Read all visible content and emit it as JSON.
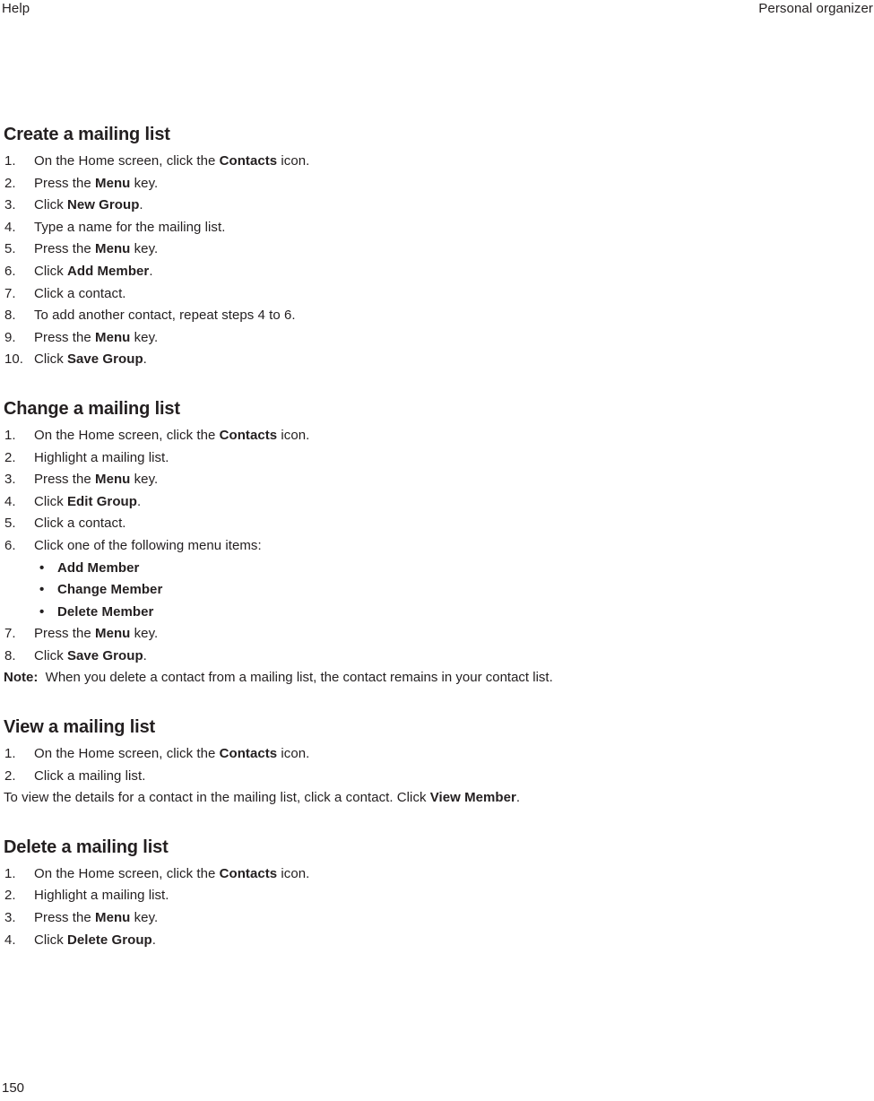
{
  "running_head": {
    "left": "Help",
    "right": "Personal organizer"
  },
  "page_number": "150",
  "sections": [
    {
      "title": "Create a mailing list",
      "steps": [
        {
          "num": "1.",
          "parts": [
            {
              "t": "On the Home screen, click the ",
              "b": false
            },
            {
              "t": "Contacts",
              "b": true
            },
            {
              "t": " icon.",
              "b": false
            }
          ]
        },
        {
          "num": "2.",
          "parts": [
            {
              "t": "Press the ",
              "b": false
            },
            {
              "t": "Menu",
              "b": true
            },
            {
              "t": " key.",
              "b": false
            }
          ]
        },
        {
          "num": "3.",
          "parts": [
            {
              "t": "Click ",
              "b": false
            },
            {
              "t": "New Group",
              "b": true
            },
            {
              "t": ".",
              "b": false
            }
          ]
        },
        {
          "num": "4.",
          "parts": [
            {
              "t": "Type a name for the mailing list.",
              "b": false
            }
          ]
        },
        {
          "num": "5.",
          "parts": [
            {
              "t": "Press the ",
              "b": false
            },
            {
              "t": "Menu",
              "b": true
            },
            {
              "t": " key.",
              "b": false
            }
          ]
        },
        {
          "num": "6.",
          "parts": [
            {
              "t": "Click ",
              "b": false
            },
            {
              "t": "Add Member",
              "b": true
            },
            {
              "t": ".",
              "b": false
            }
          ]
        },
        {
          "num": "7.",
          "parts": [
            {
              "t": "Click a contact.",
              "b": false
            }
          ]
        },
        {
          "num": "8.",
          "parts": [
            {
              "t": "To add another contact, repeat steps 4 to 6.",
              "b": false
            }
          ]
        },
        {
          "num": "9.",
          "parts": [
            {
              "t": "Press the ",
              "b": false
            },
            {
              "t": "Menu",
              "b": true
            },
            {
              "t": " key.",
              "b": false
            }
          ]
        },
        {
          "num": "10.",
          "parts": [
            {
              "t": "Click ",
              "b": false
            },
            {
              "t": "Save Group",
              "b": true
            },
            {
              "t": ".",
              "b": false
            }
          ]
        }
      ]
    },
    {
      "title": "Change a mailing list",
      "steps": [
        {
          "num": "1.",
          "parts": [
            {
              "t": "On the Home screen, click the ",
              "b": false
            },
            {
              "t": "Contacts",
              "b": true
            },
            {
              "t": " icon.",
              "b": false
            }
          ]
        },
        {
          "num": "2.",
          "parts": [
            {
              "t": "Highlight a mailing list.",
              "b": false
            }
          ]
        },
        {
          "num": "3.",
          "parts": [
            {
              "t": "Press the ",
              "b": false
            },
            {
              "t": "Menu",
              "b": true
            },
            {
              "t": " key.",
              "b": false
            }
          ]
        },
        {
          "num": "4.",
          "parts": [
            {
              "t": "Click ",
              "b": false
            },
            {
              "t": "Edit Group",
              "b": true
            },
            {
              "t": ".",
              "b": false
            }
          ]
        },
        {
          "num": "5.",
          "parts": [
            {
              "t": "Click a contact.",
              "b": false
            }
          ]
        },
        {
          "num": "6.",
          "parts": [
            {
              "t": "Click one of the following menu items:",
              "b": false
            }
          ],
          "subitems": [
            "Add Member",
            "Change Member",
            "Delete Member"
          ],
          "bullet_glyph": "•"
        },
        {
          "num": "7.",
          "parts": [
            {
              "t": "Press the ",
              "b": false
            },
            {
              "t": "Menu",
              "b": true
            },
            {
              "t": " key.",
              "b": false
            }
          ]
        },
        {
          "num": "8.",
          "parts": [
            {
              "t": "Click ",
              "b": false
            },
            {
              "t": "Save Group",
              "b": true
            },
            {
              "t": ".",
              "b": false
            }
          ]
        }
      ],
      "note": {
        "label": "Note:",
        "text": "When you delete a contact from a mailing list, the contact remains in your contact list."
      }
    },
    {
      "title": "View a mailing list",
      "steps": [
        {
          "num": "1.",
          "parts": [
            {
              "t": "On the Home screen, click the ",
              "b": false
            },
            {
              "t": "Contacts",
              "b": true
            },
            {
              "t": " icon.",
              "b": false
            }
          ]
        },
        {
          "num": "2.",
          "parts": [
            {
              "t": "Click a mailing list.",
              "b": false
            }
          ]
        }
      ],
      "paragraph": [
        {
          "t": "To view the details for a contact in the mailing list, click a contact. Click ",
          "b": false
        },
        {
          "t": "View Member",
          "b": true
        },
        {
          "t": ".",
          "b": false
        }
      ]
    },
    {
      "title": "Delete a mailing list",
      "steps": [
        {
          "num": "1.",
          "parts": [
            {
              "t": "On the Home screen, click the ",
              "b": false
            },
            {
              "t": "Contacts",
              "b": true
            },
            {
              "t": " icon.",
              "b": false
            }
          ]
        },
        {
          "num": "2.",
          "parts": [
            {
              "t": "Highlight a mailing list.",
              "b": false
            }
          ]
        },
        {
          "num": "3.",
          "parts": [
            {
              "t": "Press the ",
              "b": false
            },
            {
              "t": "Menu",
              "b": true
            },
            {
              "t": " key.",
              "b": false
            }
          ]
        },
        {
          "num": "4.",
          "parts": [
            {
              "t": "Click ",
              "b": false
            },
            {
              "t": "Delete Group",
              "b": true
            },
            {
              "t": ".",
              "b": false
            }
          ]
        }
      ]
    }
  ]
}
